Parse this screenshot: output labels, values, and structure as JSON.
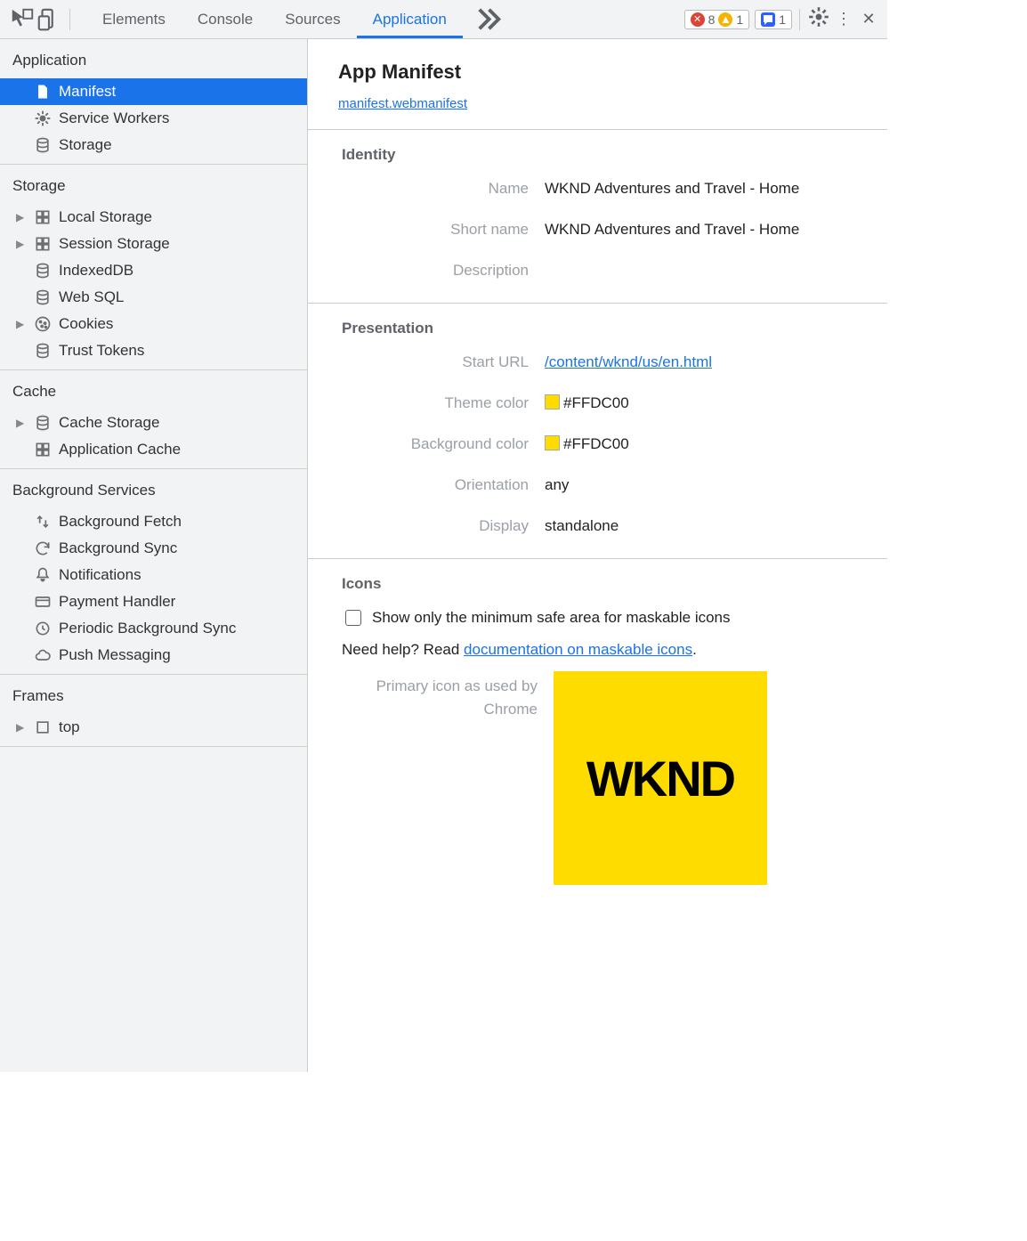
{
  "toolbar": {
    "tabs": [
      "Elements",
      "Console",
      "Sources",
      "Application"
    ],
    "active_tab": "Application",
    "error_count": "8",
    "warning_count": "1",
    "issue_count": "1"
  },
  "sidebar": {
    "groups": [
      {
        "title": "Application",
        "items": [
          {
            "id": "manifest",
            "label": "Manifest",
            "icon": "document-icon",
            "selected": true,
            "disclosure": false
          },
          {
            "id": "service-workers",
            "label": "Service Workers",
            "icon": "gear-icon",
            "disclosure": false
          },
          {
            "id": "storage",
            "label": "Storage",
            "icon": "database-icon",
            "disclosure": false
          }
        ]
      },
      {
        "title": "Storage",
        "items": [
          {
            "id": "local-storage",
            "label": "Local Storage",
            "icon": "grid-icon",
            "disclosure": true
          },
          {
            "id": "session-storage",
            "label": "Session Storage",
            "icon": "grid-icon",
            "disclosure": true
          },
          {
            "id": "indexeddb",
            "label": "IndexedDB",
            "icon": "database-icon",
            "disclosure": false
          },
          {
            "id": "web-sql",
            "label": "Web SQL",
            "icon": "database-icon",
            "disclosure": false
          },
          {
            "id": "cookies",
            "label": "Cookies",
            "icon": "cookie-icon",
            "disclosure": true
          },
          {
            "id": "trust-tokens",
            "label": "Trust Tokens",
            "icon": "database-icon",
            "disclosure": false
          }
        ]
      },
      {
        "title": "Cache",
        "items": [
          {
            "id": "cache-storage",
            "label": "Cache Storage",
            "icon": "database-icon",
            "disclosure": true
          },
          {
            "id": "application-cache",
            "label": "Application Cache",
            "icon": "grid-icon",
            "disclosure": false
          }
        ]
      },
      {
        "title": "Background Services",
        "items": [
          {
            "id": "background-fetch",
            "label": "Background Fetch",
            "icon": "updown-icon",
            "disclosure": false
          },
          {
            "id": "background-sync",
            "label": "Background Sync",
            "icon": "sync-icon",
            "disclosure": false
          },
          {
            "id": "notifications",
            "label": "Notifications",
            "icon": "bell-icon",
            "disclosure": false
          },
          {
            "id": "payment-handler",
            "label": "Payment Handler",
            "icon": "card-icon",
            "disclosure": false
          },
          {
            "id": "periodic-background-sync",
            "label": "Periodic Background Sync",
            "icon": "clock-icon",
            "disclosure": false
          },
          {
            "id": "push-messaging",
            "label": "Push Messaging",
            "icon": "cloud-icon",
            "disclosure": false
          }
        ]
      },
      {
        "title": "Frames",
        "items": [
          {
            "id": "top",
            "label": "top",
            "icon": "frame-icon",
            "disclosure": true
          }
        ]
      }
    ]
  },
  "main": {
    "title": "App Manifest",
    "manifest_link": "manifest.webmanifest",
    "sections": {
      "identity": {
        "title": "Identity",
        "name_label": "Name",
        "name_value": "WKND Adventures and Travel - Home",
        "shortname_label": "Short name",
        "shortname_value": "WKND Adventures and Travel - Home",
        "description_label": "Description",
        "description_value": ""
      },
      "presentation": {
        "title": "Presentation",
        "starturl_label": "Start URL",
        "starturl_value": "/content/wknd/us/en.html",
        "themecolor_label": "Theme color",
        "themecolor_value": "#FFDC00",
        "bgcolor_label": "Background color",
        "bgcolor_value": "#FFDC00",
        "orientation_label": "Orientation",
        "orientation_value": "any",
        "display_label": "Display",
        "display_value": "standalone"
      },
      "icons": {
        "title": "Icons",
        "checkbox_label": "Show only the minimum safe area for maskable icons",
        "help_prefix": "Need help? Read ",
        "help_link": "documentation on maskable icons",
        "help_suffix": ".",
        "primary_caption": "Primary icon as used by Chrome",
        "logo_text": "WKND",
        "logo_bg": "#FFDC00"
      }
    }
  }
}
